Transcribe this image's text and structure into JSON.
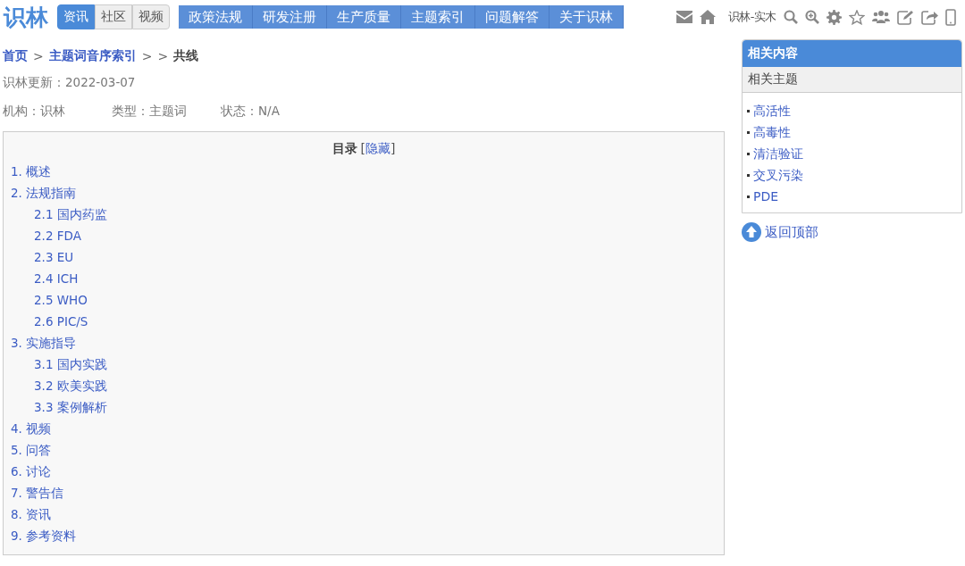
{
  "logo": "识林",
  "channel_tabs": [
    {
      "label": "资讯",
      "selected": true
    },
    {
      "label": "社区",
      "selected": false
    },
    {
      "label": "视频",
      "selected": false
    }
  ],
  "nav": [
    "政策法规",
    "研发注册",
    "生产质量",
    "主题索引",
    "问题解答",
    "关于识林"
  ],
  "user_label": "识林-实木",
  "breadcrumb": [
    {
      "text": "首页",
      "kind": "link"
    },
    {
      "text": ">",
      "kind": "sep"
    },
    {
      "text": "主题词音序索引",
      "kind": "link"
    },
    {
      "text": ">",
      "kind": "sep"
    },
    {
      "text": ">",
      "kind": "sep"
    },
    {
      "text": "共线",
      "kind": "current"
    }
  ],
  "updated": "识林更新：2022-03-07",
  "meta": [
    "机构：识林",
    "类型：主题词",
    "状态：N/A"
  ],
  "toc": {
    "title": "目录",
    "toggle_open": "[",
    "toggle": "隐藏",
    "toggle_close": "]",
    "items": [
      {
        "label": "1. 概述"
      },
      {
        "label": "2. 法规指南",
        "children": [
          {
            "label": "2.1 国内药监"
          },
          {
            "label": "2.2 FDA"
          },
          {
            "label": "2.3 EU"
          },
          {
            "label": "2.4 ICH"
          },
          {
            "label": "2.5 WHO"
          },
          {
            "label": "2.6 PIC/S"
          }
        ]
      },
      {
        "label": "3. 实施指导",
        "children": [
          {
            "label": "3.1 国内实践"
          },
          {
            "label": "3.2 欧美实践"
          },
          {
            "label": "3.3 案例解析"
          }
        ]
      },
      {
        "label": "4. 视频"
      },
      {
        "label": "5. 问答"
      },
      {
        "label": "6. 讨论"
      },
      {
        "label": "7. 警告信"
      },
      {
        "label": "8. 资讯"
      },
      {
        "label": "9. 参考资料"
      }
    ]
  },
  "sidebar": {
    "title": "相关内容",
    "subtitle": "相关主题",
    "links": [
      "高活性",
      "高毒性",
      "清洁验证",
      "交叉污染",
      "PDE"
    ]
  },
  "back_to_top": "返回顶部"
}
